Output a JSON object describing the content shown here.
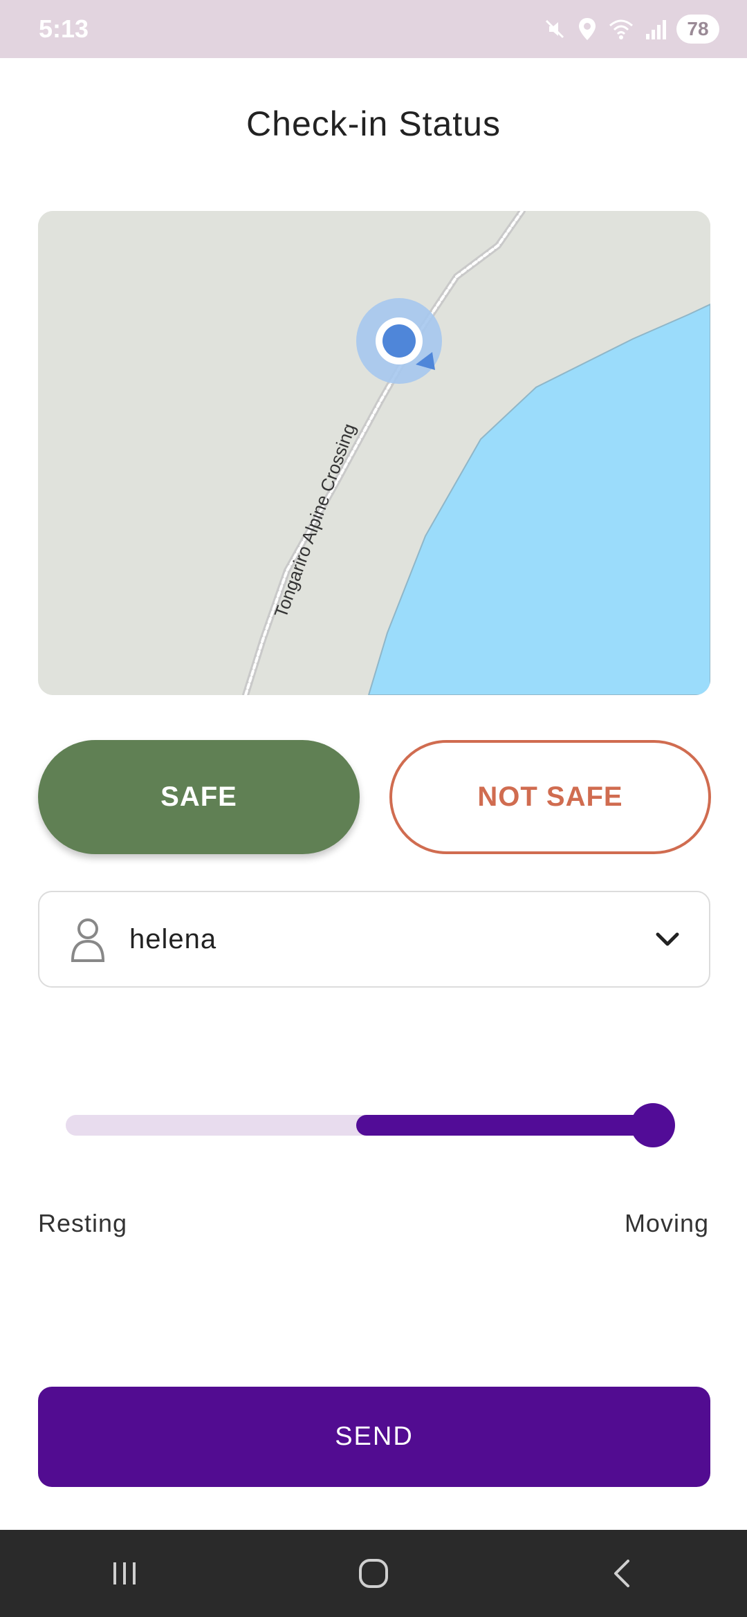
{
  "status_bar": {
    "time": "5:13",
    "battery": "78",
    "icons": [
      "mute-icon",
      "location-icon",
      "wifi-icon",
      "signal-icon"
    ]
  },
  "page": {
    "title": "Check-in Status"
  },
  "map": {
    "road_label": "Tongariro Alpine Crossing"
  },
  "actions": {
    "safe_label": "SAFE",
    "not_safe_label": "NOT SAFE"
  },
  "user_select": {
    "selected": "helena",
    "icon": "person-icon"
  },
  "activity": {
    "min_label": "Resting",
    "max_label": "Moving",
    "range_start": 0.48,
    "range_end": 0.97
  },
  "send": {
    "label": "SEND"
  },
  "colors": {
    "safe": "#608054",
    "not_safe": "#d06c50",
    "primary": "#520c91",
    "water": "#9bdcfb",
    "land": "#e0e2dc",
    "status_bar": "#e2d4df"
  },
  "nav": {
    "items": [
      "recents-icon",
      "home-icon",
      "back-icon"
    ]
  }
}
